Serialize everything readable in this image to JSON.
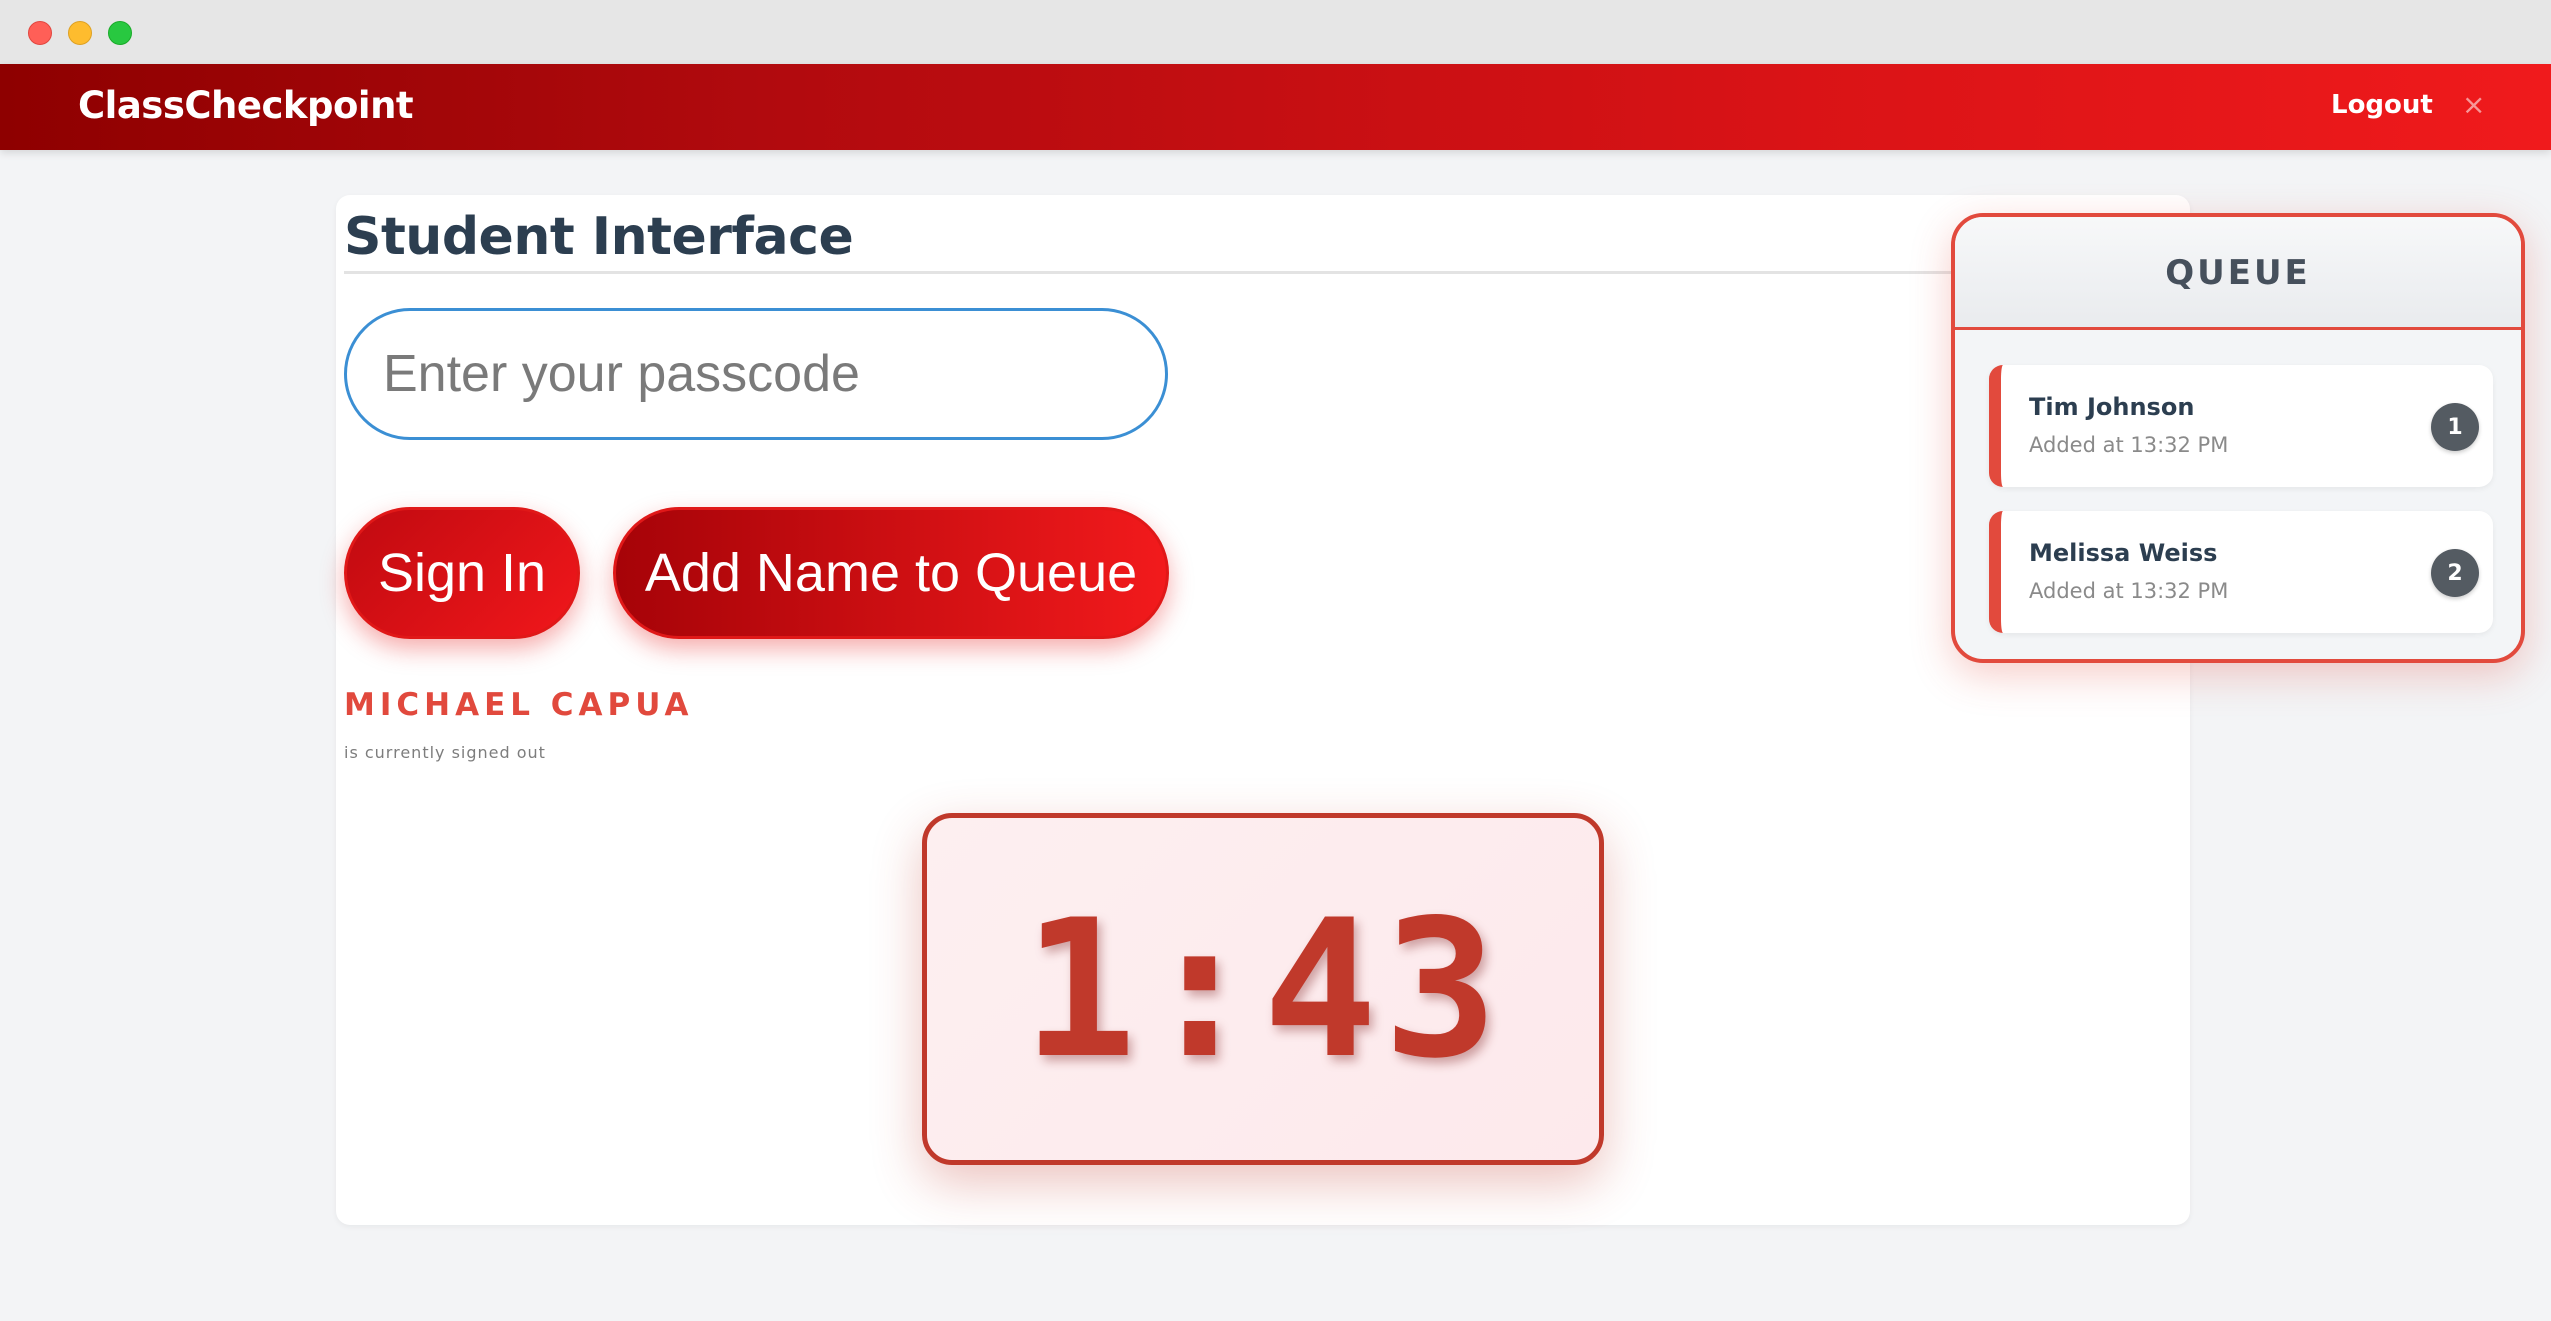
{
  "app": {
    "brand": "ClassCheckpoint",
    "logout_label": "Logout",
    "close_glyph": "×"
  },
  "main": {
    "title": "Student Interface",
    "passcode_placeholder": "Enter your passcode",
    "signin_label": "Sign In",
    "add_queue_label": "Add Name to Queue",
    "student_name": "MICHAEL CAPUA",
    "student_status": "is currently signed out",
    "timer": "1:43"
  },
  "queue": {
    "title": "QUEUE",
    "items": [
      {
        "name": "Tim Johnson",
        "time": "Added at 13:32 PM",
        "position": "1"
      },
      {
        "name": "Melissa Weiss",
        "time": "Added at 13:32 PM",
        "position": "2"
      }
    ]
  },
  "colors": {
    "accent": "#e24a3d",
    "header_start": "#8e0000",
    "header_end": "#f01a1c",
    "timer": "#c0392b",
    "input_border": "#3b8fd4"
  },
  "icons": {
    "close": "close-icon"
  }
}
